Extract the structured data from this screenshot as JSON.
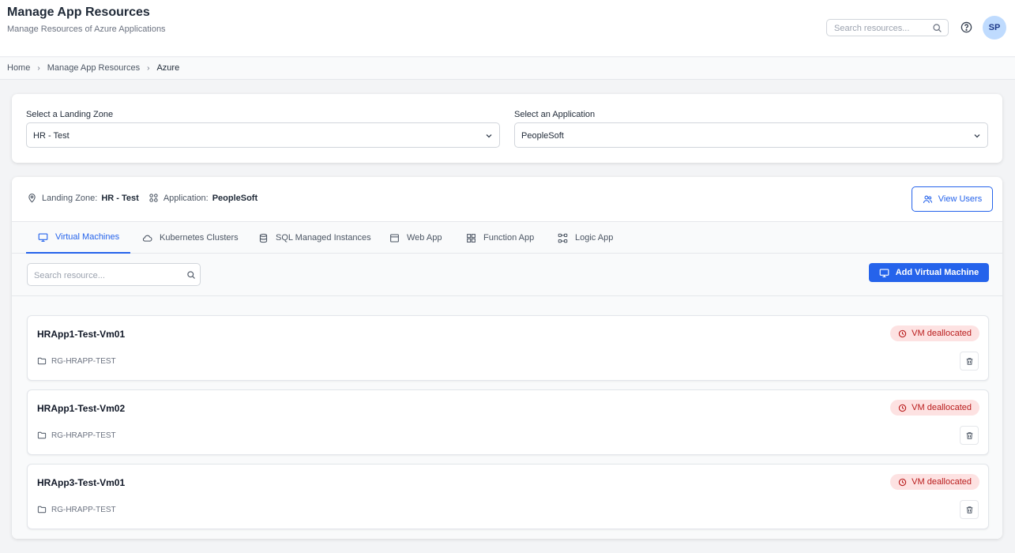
{
  "header": {
    "title": "Manage App Resources",
    "subtitle": "Manage Resources of Azure Applications",
    "search_placeholder": "Search resources...",
    "avatar_initials": "SP"
  },
  "breadcrumb": [
    "Home",
    "Manage App Resources",
    "Azure"
  ],
  "selectors": {
    "landing_zone_label": "Select a Landing Zone",
    "landing_zone_value": "HR - Test",
    "application_label": "Select an Application",
    "application_value": "PeopleSoft"
  },
  "context": {
    "landing_zone_label": "Landing Zone:",
    "landing_zone_value": "HR - Test",
    "application_label": "Application:",
    "application_value": "PeopleSoft",
    "view_users_label": "View Users"
  },
  "tabs": [
    {
      "label": "Virtual Machines",
      "icon": "monitor-icon",
      "active": true
    },
    {
      "label": "Kubernetes Clusters",
      "icon": "cloud-icon",
      "active": false
    },
    {
      "label": "SQL Managed Instances",
      "icon": "database-icon",
      "active": false
    },
    {
      "label": "Web App",
      "icon": "browser-window-icon",
      "active": false
    },
    {
      "label": "Function App",
      "icon": "grid-icon",
      "active": false
    },
    {
      "label": "Logic App",
      "icon": "workflow-icon",
      "active": false
    }
  ],
  "toolbar": {
    "search_placeholder": "Search resource...",
    "add_button_label": "Add Virtual Machine"
  },
  "vms": [
    {
      "name": "HRApp1-Test-Vm01",
      "resource_group": "RG-HRAPP-TEST",
      "status": "VM deallocated"
    },
    {
      "name": "HRApp1-Test-Vm02",
      "resource_group": "RG-HRAPP-TEST",
      "status": "VM deallocated"
    },
    {
      "name": "HRApp3-Test-Vm01",
      "resource_group": "RG-HRAPP-TEST",
      "status": "VM deallocated"
    }
  ],
  "colors": {
    "accent": "#2563eb",
    "status_bg": "#fde2e2",
    "status_text": "#b91c1c"
  }
}
